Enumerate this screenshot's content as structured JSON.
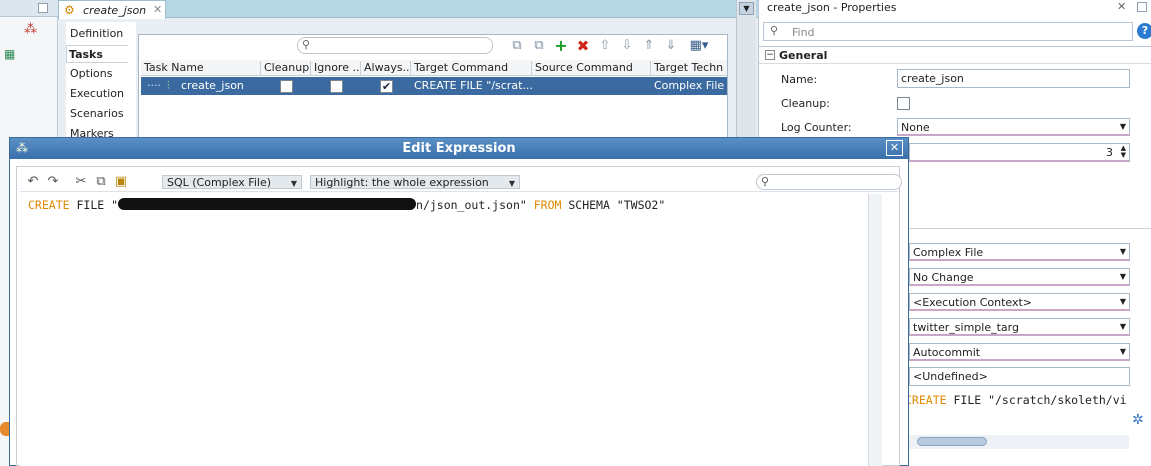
{
  "editor_tab": {
    "title": "create_json"
  },
  "vertical_tabs": [
    "Definition",
    "Tasks",
    "Options",
    "Execution",
    "Scenarios",
    "Markers"
  ],
  "task_table": {
    "columns": [
      "Task Name",
      "Cleanup",
      "Ignore ...",
      "Always...",
      "Target Command",
      "Source Command",
      "Target Techn"
    ],
    "row": {
      "task_name": "create_json",
      "cleanup": false,
      "ignore": false,
      "always": true,
      "target_command": "CREATE FILE \"/scrat...",
      "source_command": "",
      "target_tech": "Complex File"
    }
  },
  "properties": {
    "title": "create_json - Properties",
    "find_placeholder": "Find",
    "section": "General",
    "name_label": "Name:",
    "name_value": "create_json",
    "cleanup_label": "Cleanup:",
    "log_counter_label": "Log Counter:",
    "log_counter_value": "None",
    "spinner_value": "3",
    "combos": [
      "Complex File",
      "No Change",
      "<Execution Context>",
      "twitter_simple_targ",
      "Autocommit"
    ],
    "undefined_value": "<Undefined>",
    "expression_preview_kw": "CREATE",
    "expression_preview_rest": " FILE \"/scratch/skoleth/vi"
  },
  "dialog": {
    "title": "Edit Expression",
    "language_combo": "SQL (Complex File)",
    "highlight_combo": "Highlight: the whole expression",
    "code": {
      "kw1": "CREATE",
      "part1": " FILE \"",
      "part2": "n/json_out.json\" ",
      "kw2": "FROM",
      "part3": " SCHEMA \"TWSO2\""
    }
  }
}
